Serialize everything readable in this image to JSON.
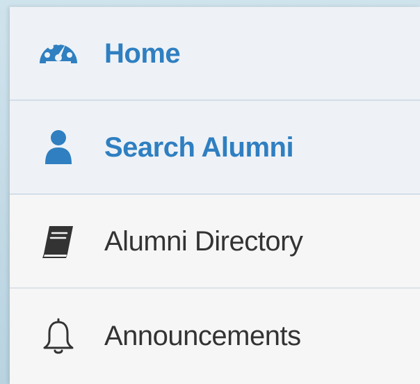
{
  "menu": {
    "items": [
      {
        "label": "Home",
        "icon": "dashboard-icon",
        "active": true
      },
      {
        "label": "Search Alumni",
        "icon": "user-icon",
        "active": true
      },
      {
        "label": "Alumni Directory",
        "icon": "book-icon",
        "active": false
      },
      {
        "label": "Announcements",
        "icon": "bell-icon",
        "active": false
      }
    ]
  },
  "colors": {
    "accent": "#2f7fc1",
    "text": "#333333",
    "active_bg": "#eef2f6"
  }
}
